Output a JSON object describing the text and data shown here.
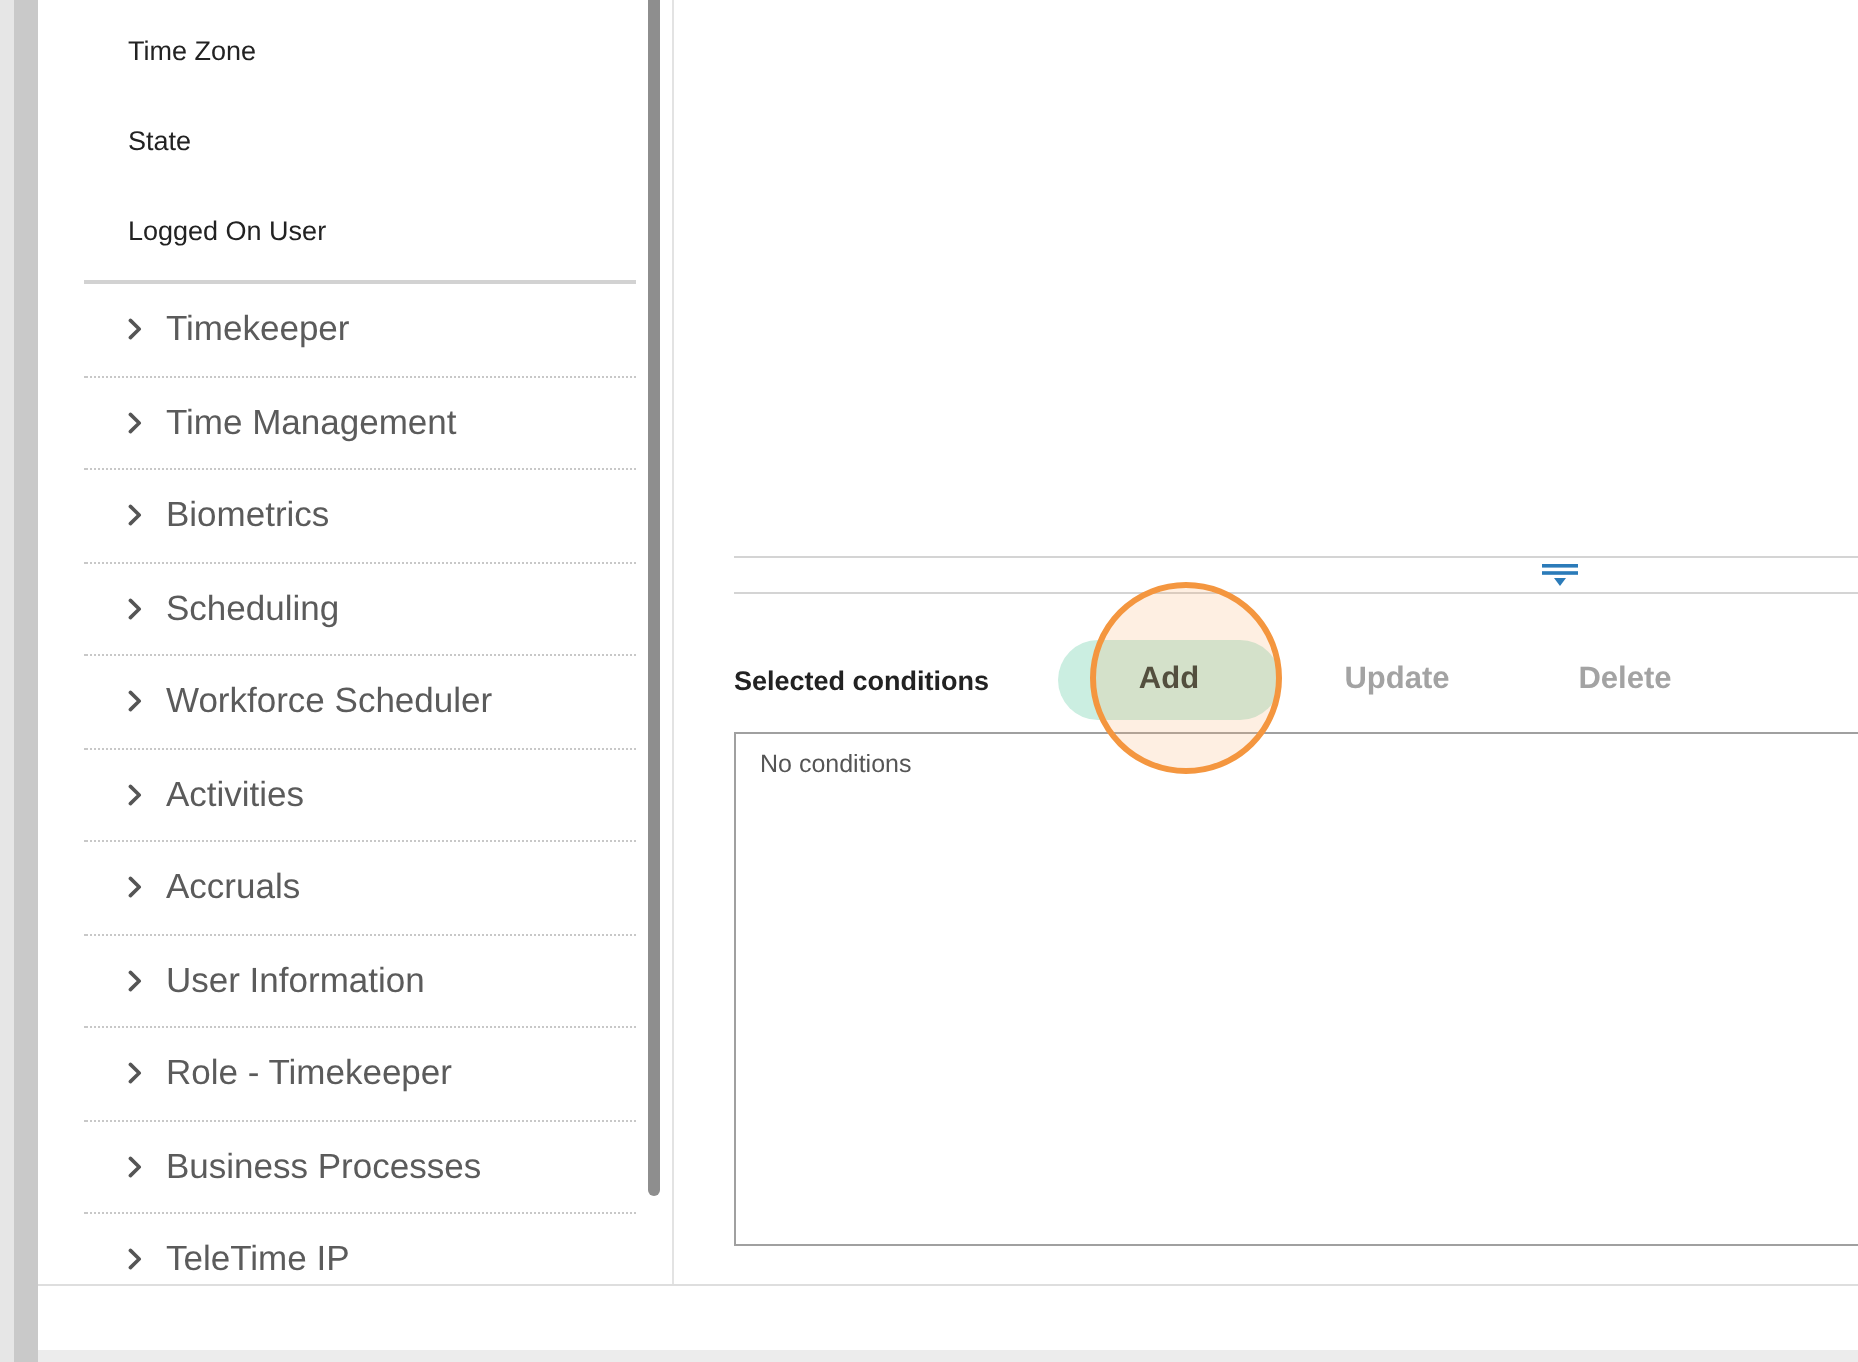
{
  "sidebar": {
    "fields": [
      {
        "label": "Time Zone"
      },
      {
        "label": "State"
      },
      {
        "label": "Logged On User"
      }
    ],
    "sections": [
      {
        "label": "Timekeeper",
        "expanded": false
      },
      {
        "label": "Time Management",
        "expanded": false
      },
      {
        "label": "Biometrics",
        "expanded": false
      },
      {
        "label": "Scheduling",
        "expanded": false
      },
      {
        "label": "Workforce Scheduler",
        "expanded": false
      },
      {
        "label": "Activities",
        "expanded": false
      },
      {
        "label": "Accruals",
        "expanded": false
      },
      {
        "label": "User Information",
        "expanded": false
      },
      {
        "label": "Role - Timekeeper",
        "expanded": false
      },
      {
        "label": "Business Processes",
        "expanded": false
      },
      {
        "label": "TeleTime IP",
        "expanded": false
      }
    ]
  },
  "conditions": {
    "title": "Selected conditions",
    "buttons": [
      {
        "label": "Add",
        "disabled": false,
        "highlighted": true
      },
      {
        "label": "Update",
        "disabled": true,
        "highlighted": false
      },
      {
        "label": "Delete",
        "disabled": true,
        "highlighted": false
      }
    ],
    "empty_text": "No conditions"
  }
}
